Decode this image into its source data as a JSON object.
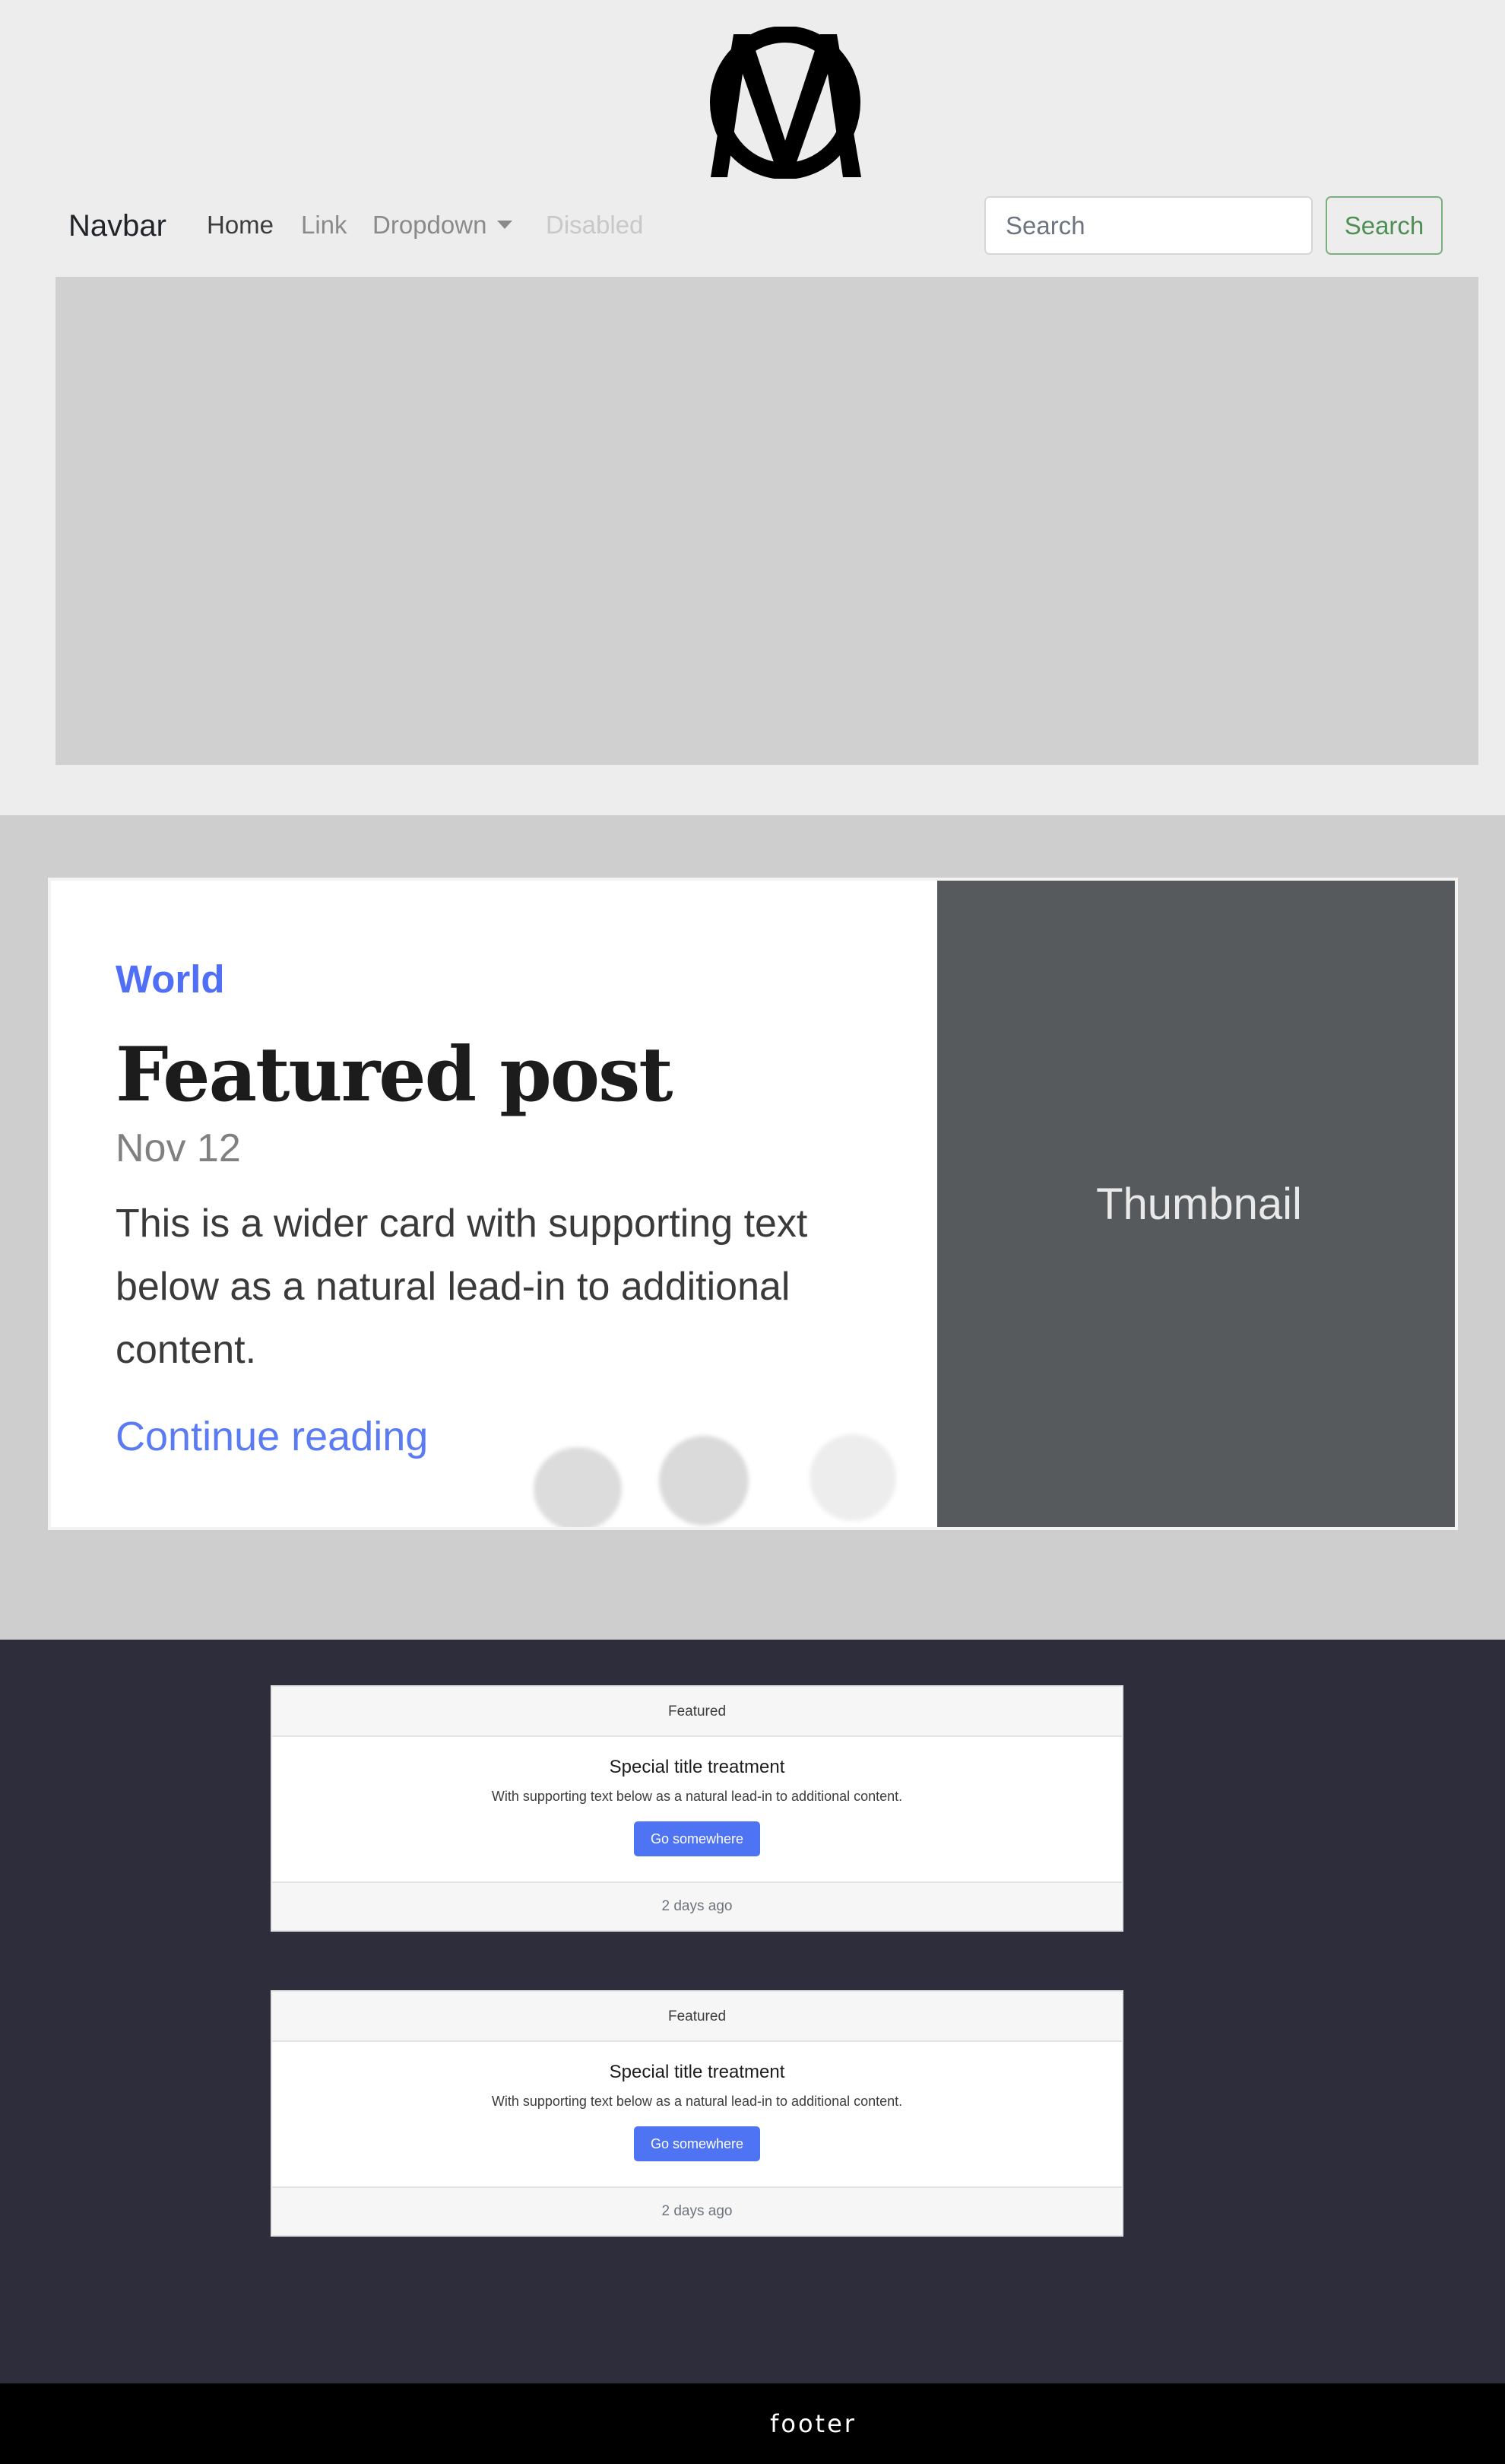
{
  "logo": {
    "alt": "MC monogram logo"
  },
  "navbar": {
    "brand": "Navbar",
    "links": [
      "Home",
      "Link",
      "Dropdown",
      "Disabled"
    ],
    "search": {
      "placeholder": "Search",
      "value": ""
    },
    "search_button": "Search"
  },
  "featured": {
    "category": "World",
    "title": "Featured post",
    "date": "Nov 12",
    "text": "This is a wider card with supporting text below as a natural lead-in to additional content.",
    "link": "Continue reading",
    "thumbnail": "Thumbnail"
  },
  "cards": [
    {
      "header": "Featured",
      "title": "Special title treatment",
      "text": "With supporting text below as a natural lead-in to additional content.",
      "button": "Go somewhere",
      "footer": "2 days ago"
    },
    {
      "header": "Featured",
      "title": "Special title treatment",
      "text": "With supporting text below as a natural lead-in to additional content.",
      "button": "Go somewhere",
      "footer": "2 days ago"
    }
  ],
  "footer": {
    "text": "footer"
  },
  "colors": {
    "accent": "#4f6ff7",
    "button": "#4e73f3",
    "search_outline": "#7bb07f",
    "dark_section": "#2e2d3b",
    "thumbnail_bg": "#575a5d"
  }
}
